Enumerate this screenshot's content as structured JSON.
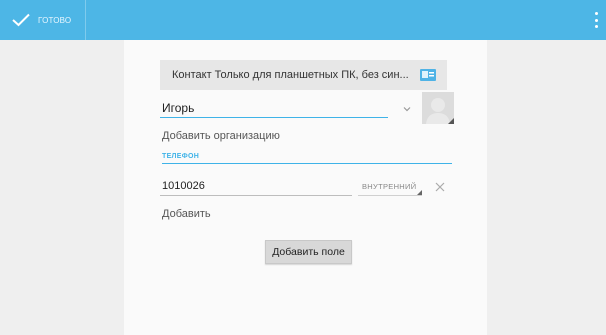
{
  "action_bar": {
    "done_label": "ГОТОВО",
    "done_icon": "checkmark-icon",
    "overflow_icon": "overflow-menu-icon",
    "bar_color": "#4db6e6"
  },
  "account": {
    "text": "Контакт Только для планшетных ПК, без син...",
    "icon": "contact-card-icon"
  },
  "name": {
    "value": "Игорь",
    "expand_icon": "chevron-down-icon"
  },
  "photo": {
    "icon": "contact-photo-placeholder"
  },
  "add_organization_label": "Добавить организацию",
  "phone_section": {
    "header": "ТЕЛЕФОН",
    "value": "1010026",
    "type": "ВНУТРЕННИЙ",
    "delete_icon": "close-icon",
    "add_label": "Добавить"
  },
  "add_field_button": "Добавить поле",
  "accent_color": "#3fb3e8"
}
